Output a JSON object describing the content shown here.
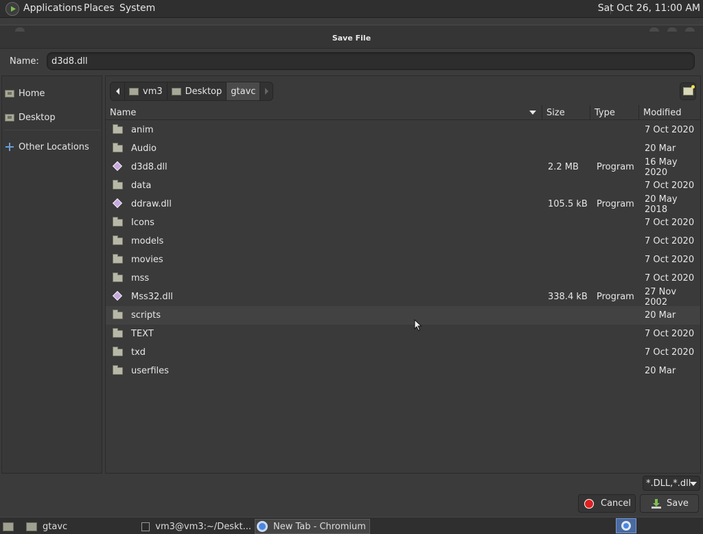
{
  "top_panel": {
    "menus": [
      "Applications",
      "Places",
      "System"
    ],
    "clock": "Sat Oct 26, 11:00 AM"
  },
  "dialog": {
    "title": "Save File",
    "name_label": "Name:",
    "name_value": "d3d8.dll",
    "sidebar": [
      {
        "label": "Home",
        "icon": "home-folder-icon"
      },
      {
        "label": "Desktop",
        "icon": "desktop-folder-icon"
      },
      {
        "label": "Other Locations",
        "icon": "plus-icon"
      }
    ],
    "path": [
      "vm3",
      "Desktop",
      "gtavc"
    ],
    "columns": {
      "name": "Name",
      "size": "Size",
      "type": "Type",
      "modified": "Modified"
    },
    "files": [
      {
        "name": "anim",
        "kind": "folder",
        "size": "",
        "type": "",
        "modified": "7 Oct 2020"
      },
      {
        "name": "Audio",
        "kind": "folder",
        "size": "",
        "type": "",
        "modified": "20 Mar"
      },
      {
        "name": "d3d8.dll",
        "kind": "file",
        "size": "2.2 MB",
        "type": "Program",
        "modified": "16 May 2020"
      },
      {
        "name": "data",
        "kind": "folder",
        "size": "",
        "type": "",
        "modified": "7 Oct 2020"
      },
      {
        "name": "ddraw.dll",
        "kind": "file",
        "size": "105.5 kB",
        "type": "Program",
        "modified": "20 May 2018"
      },
      {
        "name": "Icons",
        "kind": "folder",
        "size": "",
        "type": "",
        "modified": "7 Oct 2020"
      },
      {
        "name": "models",
        "kind": "folder",
        "size": "",
        "type": "",
        "modified": "7 Oct 2020"
      },
      {
        "name": "movies",
        "kind": "folder",
        "size": "",
        "type": "",
        "modified": "7 Oct 2020"
      },
      {
        "name": "mss",
        "kind": "folder",
        "size": "",
        "type": "",
        "modified": "7 Oct 2020"
      },
      {
        "name": "Mss32.dll",
        "kind": "file",
        "size": "338.4 kB",
        "type": "Program",
        "modified": "27 Nov 2002"
      },
      {
        "name": "scripts",
        "kind": "folder",
        "size": "",
        "type": "",
        "modified": "20 Mar"
      },
      {
        "name": "TEXT",
        "kind": "folder",
        "size": "",
        "type": "",
        "modified": "7 Oct 2020"
      },
      {
        "name": "txd",
        "kind": "folder",
        "size": "",
        "type": "",
        "modified": "7 Oct 2020"
      },
      {
        "name": "userfiles",
        "kind": "folder",
        "size": "",
        "type": "",
        "modified": "20 Mar"
      }
    ],
    "hover_row": "scripts",
    "filter": "*.DLL,*.dll",
    "cancel_label": "Cancel",
    "save_label": "Save"
  },
  "taskbar": {
    "items": [
      "gtavc",
      "vm3@vm3:~/Deskt...",
      "New Tab - Chromium"
    ],
    "active": "New Tab - Chromium"
  }
}
